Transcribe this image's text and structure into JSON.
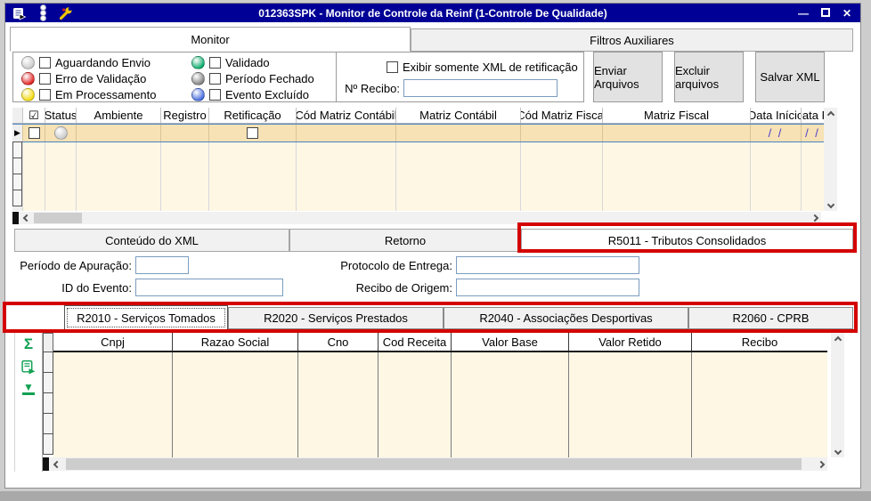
{
  "titlebar": {
    "title": "012363SPK - Monitor de Controle da Reinf (1-Controle De Qualidade)",
    "minimize_glyph": "—",
    "close_glyph": "✕"
  },
  "main_tabs": {
    "monitor": "Monitor",
    "filtros": "Filtros Auxiliares"
  },
  "legend": {
    "items": [
      {
        "label": "Aguardando Envio",
        "color": "#c8c8c8"
      },
      {
        "label": "Erro de Validação",
        "color": "#e01818"
      },
      {
        "label": "Em Processamento",
        "color": "#f2d800"
      },
      {
        "label": "Validado",
        "color": "#00a864"
      },
      {
        "label": "Período Fechado",
        "color": "#7d7d7d"
      },
      {
        "label": "Evento Excluído",
        "color": "#3c64dc"
      }
    ]
  },
  "filter_box": {
    "exibir_label": "Exibir somente XML de retificação",
    "recibo_label": "Nº Recibo:",
    "recibo_value": ""
  },
  "action_buttons": {
    "enviar": "Enviar Arquivos",
    "excluir": "Excluir arquivos",
    "salvar": "Salvar XML"
  },
  "monitor_grid": {
    "select_all_glyph": "☑",
    "columns": [
      "Status",
      "Ambiente",
      "Registro",
      "Retificação",
      "Cód Matriz Contábil",
      "Matriz Contábil",
      "Cód Matriz Fiscal",
      "Matriz Fiscal",
      "Data Início",
      "Data Fi"
    ],
    "selected_row": {
      "pointer_glyph": "▶",
      "data_inicio": "/ /",
      "data_fim": "/ /"
    }
  },
  "detail_tabs": {
    "conteudo": "Conteúdo do XML",
    "retorno": "Retorno",
    "r5011": "R5011 - Tributos Consolidados"
  },
  "xml_fields": {
    "periodo_label": "Período de Apuração:",
    "periodo_value": "",
    "id_evento_label": "ID do Evento:",
    "id_evento_value": "",
    "protocolo_label": "Protocolo de Entrega:",
    "protocolo_value": "",
    "recibo_origem_label": "Recibo de Origem:",
    "recibo_origem_value": ""
  },
  "event_tabs": {
    "r2010": "R2010 - Serviços Tomados",
    "r2020": "R2020 - Serviços Prestados",
    "r2040": "R2040 - Associações Desportivas",
    "r2060": "R2060 - CPRB"
  },
  "detail_grid": {
    "columns": [
      "Cnpj",
      "Razao Social",
      "Cno",
      "Cod Receita",
      "Valor Base",
      "Valor Retido",
      "Recibo"
    ],
    "toolbar": {
      "sum_glyph": "Σ",
      "goto_bottom_glyph": "▼"
    }
  },
  "colors": {
    "titlebar": "#000096",
    "highlight_annotation": "#d40000",
    "grid_background": "#fdf7e4",
    "selected_row": "#f6e2b4",
    "toolbar_icon_green": "#12a152"
  }
}
